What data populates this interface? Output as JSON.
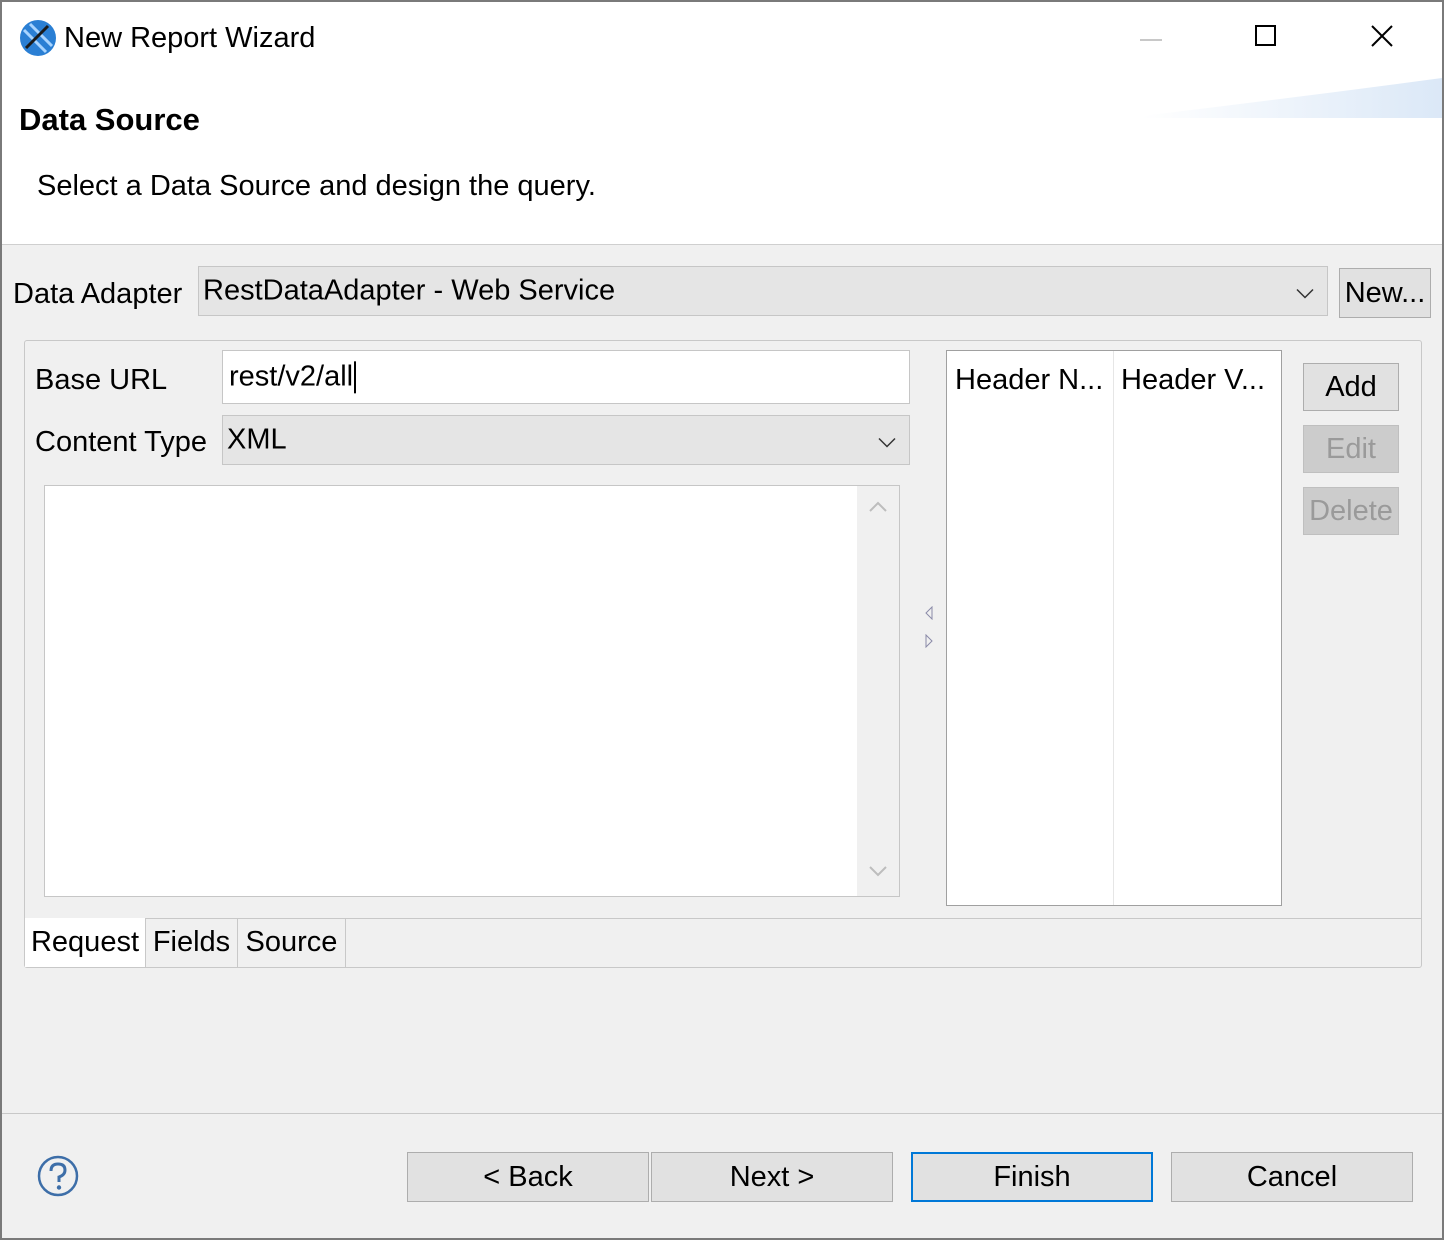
{
  "window": {
    "title": "New Report Wizard",
    "minimize_icon": "minimize-icon",
    "maximize_icon": "maximize-icon",
    "close_icon": "close-icon"
  },
  "header": {
    "title": "Data Source",
    "description": "Select a Data Source and design the query."
  },
  "adapter": {
    "label": "Data Adapter",
    "value": "RestDataAdapter  - Web Service",
    "new_button": "New..."
  },
  "request": {
    "base_url_label": "Base URL",
    "base_url_value": "rest/v2/all",
    "content_type_label": "Content Type",
    "content_type_value": "XML",
    "body_text": ""
  },
  "headers_table": {
    "columns": [
      "Header N...",
      "Header V..."
    ],
    "rows": []
  },
  "table_buttons": {
    "add": "Add",
    "edit": "Edit",
    "delete": "Delete"
  },
  "tabs": [
    {
      "label": "Request",
      "active": true
    },
    {
      "label": "Fields",
      "active": false
    },
    {
      "label": "Source",
      "active": false
    }
  ],
  "footer": {
    "help_icon": "help-icon",
    "back": "< Back",
    "next": "Next >",
    "finish": "Finish",
    "cancel": "Cancel"
  },
  "colors": {
    "accent": "#0078d7",
    "window_bg": "#f0f0f0",
    "disabled_text": "#9a9a9a"
  }
}
